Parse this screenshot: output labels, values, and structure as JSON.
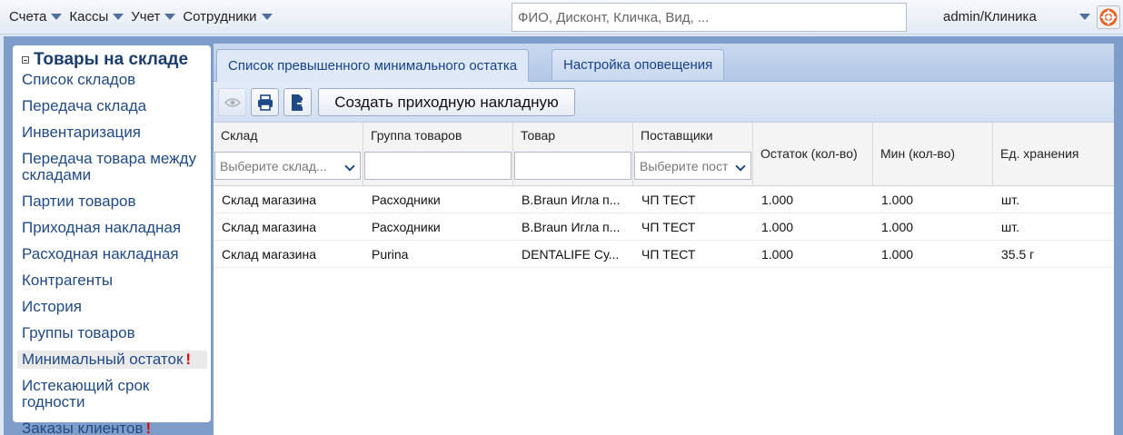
{
  "topbar": {
    "menu": [
      {
        "label": "Счета"
      },
      {
        "label": "Кассы"
      },
      {
        "label": "Учет"
      },
      {
        "label": "Сотрудники"
      }
    ],
    "search_placeholder": "ФИО, Дисконт, Кличка, Вид, ...",
    "user": "admin/Клиника"
  },
  "nav": {
    "title": "Товары на складе",
    "items": [
      {
        "label": "Список складов"
      },
      {
        "label": "Передача склада"
      },
      {
        "label": "Инвентаризация"
      },
      {
        "label": "Передача товара между складами"
      },
      {
        "label": "Партии товаров"
      },
      {
        "label": "Приходная накладная"
      },
      {
        "label": "Расходная накладная"
      },
      {
        "label": "Контрагенты"
      },
      {
        "label": "История"
      },
      {
        "label": "Группы товаров"
      },
      {
        "label": "Минимальный остаток",
        "badge": "!"
      },
      {
        "label": "Истекающий срок годности"
      },
      {
        "label": "Заказы клиентов",
        "badge": "!"
      }
    ]
  },
  "tabs": [
    {
      "label": "Список превышенного минимального остатка"
    },
    {
      "label": "Настройка оповещения"
    }
  ],
  "toolbar": {
    "create_label": "Создать приходную накладную"
  },
  "grid": {
    "columns": [
      {
        "label": "Склад",
        "filter_placeholder": "Выберите склад..."
      },
      {
        "label": "Группа товаров",
        "filter_placeholder": ""
      },
      {
        "label": "Товар",
        "filter_placeholder": ""
      },
      {
        "label": "Поставщики",
        "filter_placeholder": "Выберите пост"
      },
      {
        "label": "Остаток (кол-во)"
      },
      {
        "label": "Мин (кол-во)"
      },
      {
        "label": "Ед. хранения"
      }
    ],
    "rows": [
      [
        "Склад магазина",
        "Расходники",
        "B.Braun Игла п...",
        "ЧП ТЕСТ",
        "1.000",
        "1.000",
        "шт."
      ],
      [
        "Склад магазина",
        "Расходники",
        "B.Braun Игла п...",
        "ЧП ТЕСТ",
        "1.000",
        "1.000",
        "шт."
      ],
      [
        "Склад магазина",
        "Purina",
        "DENTALIFE Су...",
        "ЧП ТЕСТ",
        "1.000",
        "1.000",
        "35.5 г"
      ]
    ]
  },
  "colors": {
    "accent": "#1f4a85",
    "frame": "#7f9dc9",
    "badge": "#e00000"
  }
}
